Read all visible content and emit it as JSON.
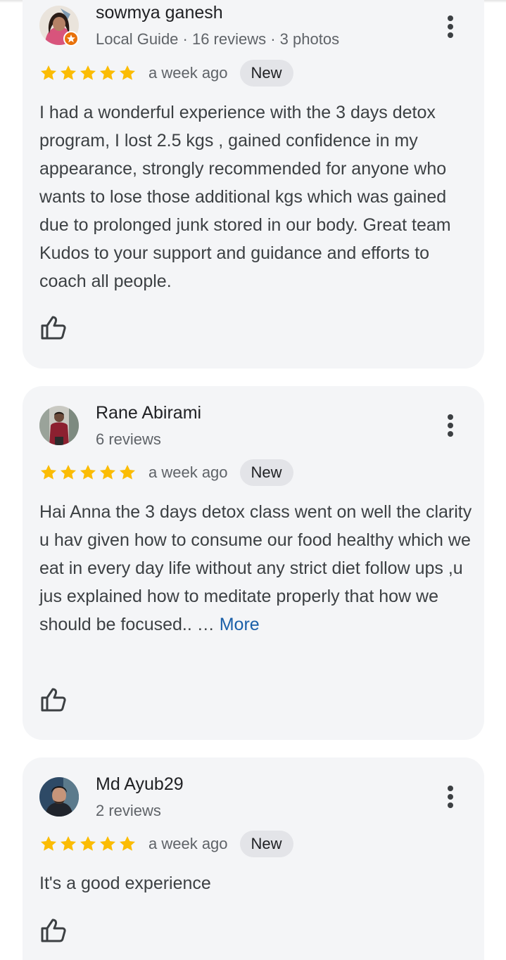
{
  "reviews": [
    {
      "author": "sowmya ganesh",
      "meta": "Local Guide · 16 reviews · 3 photos",
      "rating": 5,
      "time": "a week ago",
      "badge": "New",
      "text": "I had a wonderful experience with the 3 days detox program, I lost 2.5 kgs , gained confidence in my appearance, strongly recommended for anyone who wants to lose those additional kgs which was gained due to prolonged junk stored in our body. Great team Kudos to your support and guidance and efforts to coach all people.",
      "more": ""
    },
    {
      "author": "Rane Abirami",
      "meta": "6 reviews",
      "rating": 5,
      "time": "a week ago",
      "badge": "New",
      "text": "Hai Anna the 3 days detox class went on well the clarity u hav given how to consume our food healthy which we eat in every day life without any strict diet follow ups ,u jus explained how to meditate properly that how we should be focused.. … ",
      "more": "More"
    },
    {
      "author": "Md Ayub29",
      "meta": "2 reviews",
      "rating": 5,
      "time": "a week ago",
      "badge": "New",
      "text": "It's a good experience",
      "more": ""
    }
  ],
  "colors": {
    "star": "#fbbc04",
    "card": "#f4f5f7",
    "link": "#1a5fa8",
    "badge_bg": "#e3e4e8",
    "guide_badge": "#e8710a"
  },
  "icons": {
    "more": "more-vert-icon",
    "like": "thumb-up-outline-icon",
    "star": "star-icon",
    "guide": "local-guide-badge-icon"
  }
}
